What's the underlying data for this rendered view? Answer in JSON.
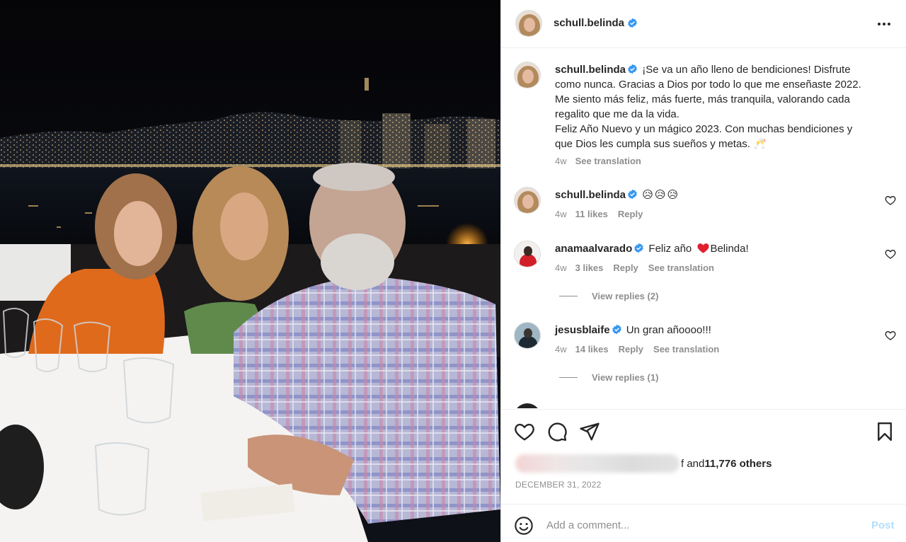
{
  "post": {
    "author": "schull.belinda",
    "verified_icon": "verified-badge-icon",
    "caption_lines": [
      "¡Se va un año lleno de bendiciones! Disfrute",
      "como nunca. Gracias a Dios por todo lo que me enseñaste 2022.",
      "Me siento más feliz, más fuerte, más tranquila, valorando cada",
      "regalito que me da la vida.",
      "Feliz Año Nuevo y un mágico 2023. Con muchas bendiciones y",
      "que Dios les cumpla sus sueños y metas. 🥂"
    ],
    "caption_time": "4w",
    "see_translation": "See translation",
    "likes_suffix_prefix": "f and ",
    "likes_count": "11,776 others",
    "date": "DECEMBER 31, 2022"
  },
  "comments": [
    {
      "user": "schull.belinda",
      "text": "😥😥😥",
      "time": "4w",
      "likes": "11 likes",
      "reply": "Reply"
    },
    {
      "user": "anamaalvarado",
      "text_before": "Feliz año ",
      "text_after": "Belinda!",
      "time": "4w",
      "likes": "3 likes",
      "reply": "Reply",
      "translation": "See translation",
      "view_replies": "View replies (2)"
    },
    {
      "user": "jesusblaife",
      "text": "Un gran añoooo!!!",
      "time": "4w",
      "likes": "14 likes",
      "reply": "Reply",
      "translation": "See translation",
      "view_replies": "View replies (1)"
    }
  ],
  "comment_box": {
    "placeholder": "Add a comment...",
    "post_label": "Post"
  },
  "colors": {
    "verified": "#3897f0",
    "text": "#262626",
    "muted": "#8e8e8e",
    "post_disabled": "#b2dffc",
    "heart_red": "#ed4956"
  }
}
